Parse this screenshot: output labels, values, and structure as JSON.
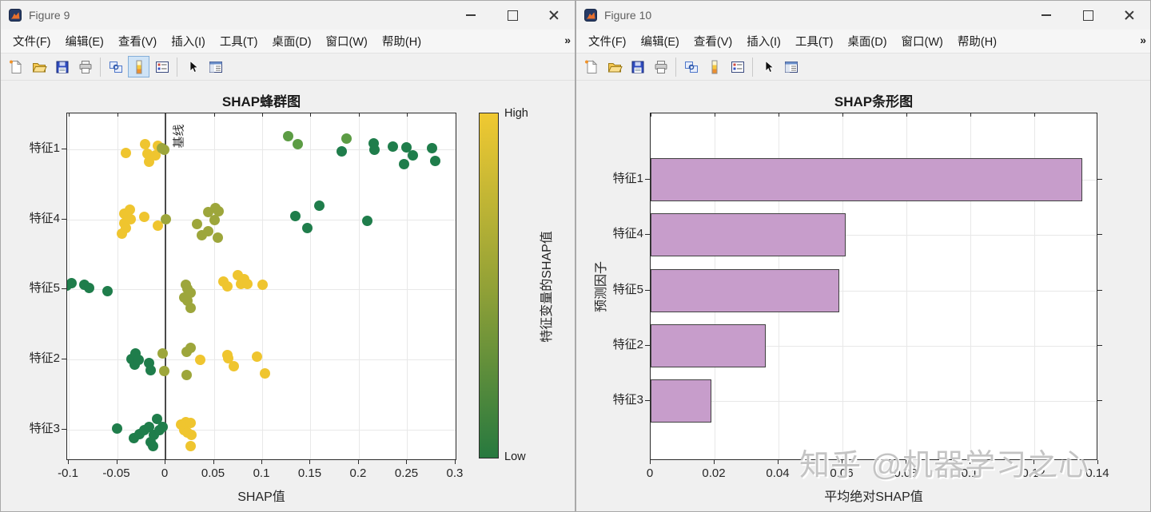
{
  "windows": {
    "left": {
      "title": "Figure 9",
      "active_tool": "insert-colorbar"
    },
    "right": {
      "title": "Figure 10",
      "active_tool": null
    }
  },
  "menu": [
    "文件(F)",
    "编辑(E)",
    "查看(V)",
    "插入(I)",
    "工具(T)",
    "桌面(D)",
    "窗口(W)",
    "帮助(H)"
  ],
  "icons": {
    "menu_overflow": "»"
  },
  "watermark": "知乎 @机器学习之心",
  "colors": {
    "figure_bg": "#F0F0F0",
    "axes_bg": "#FFFFFF",
    "grid": "#E8E8E8",
    "axis": "#2B2B2B",
    "baseline": "#4A4A4A",
    "watermark": "#C4C4C4",
    "toolbar_active_bg": "#CFE3F6",
    "toolbar_active_border": "#84AFD9",
    "cb_top": "#F0C932",
    "cb_mid": "#8FA037",
    "cb_bottom": "#27793F"
  },
  "chart_data": [
    {
      "type": "scatter",
      "title": "SHAP蜂群图",
      "xlabel": "SHAP值",
      "x_ticks": [
        "-0.1",
        "-0.05",
        "0",
        "0.05",
        "0.1",
        "0.15",
        "0.2",
        "0.25",
        "0.3"
      ],
      "xlim": [
        -0.1017,
        0.3017
      ],
      "categories": [
        "特征1",
        "特征4",
        "特征5",
        "特征2",
        "特征3"
      ],
      "baseline": {
        "x": 0,
        "label": "基线"
      },
      "colorbar": {
        "high": "High",
        "low": "Low",
        "label": "特征变量的SHAP值"
      },
      "point_colors": {
        "y": "#EFC52F",
        "o": "#9DA63B",
        "g": "#5C9C44",
        "d": "#1F7D4B"
      },
      "features": [
        {
          "name": "特征1",
          "points": [
            [
              -0.041,
              4,
              "y"
            ],
            [
              -0.021,
              -7,
              "y"
            ],
            [
              -0.019,
              5,
              "y"
            ],
            [
              -0.017,
              15,
              "y"
            ],
            [
              -0.01,
              7,
              "y"
            ],
            [
              -0.008,
              -5,
              "y"
            ],
            [
              -0.004,
              -2,
              "o"
            ],
            [
              -0.001,
              0,
              "o"
            ],
            [
              0.127,
              -17,
              "g"
            ],
            [
              0.137,
              -7,
              "g"
            ],
            [
              0.187,
              -14,
              "g"
            ],
            [
              0.182,
              2,
              "d"
            ],
            [
              0.215,
              -8,
              "d"
            ],
            [
              0.216,
              0,
              "d"
            ],
            [
              0.235,
              -4,
              "d"
            ],
            [
              0.249,
              -3,
              "d"
            ],
            [
              0.256,
              7,
              "d"
            ],
            [
              0.247,
              18,
              "d"
            ],
            [
              0.276,
              -2,
              "d"
            ],
            [
              0.279,
              14,
              "d"
            ]
          ]
        },
        {
          "name": "特征4",
          "points": [
            [
              -0.045,
              18,
              "y"
            ],
            [
              -0.043,
              -7,
              "y"
            ],
            [
              -0.043,
              5,
              "y"
            ],
            [
              -0.041,
              11,
              "y"
            ],
            [
              -0.037,
              -12,
              "y"
            ],
            [
              -0.036,
              0,
              "y"
            ],
            [
              -0.022,
              -3,
              "y"
            ],
            [
              -0.008,
              8,
              "y"
            ],
            [
              0,
              0,
              "o"
            ],
            [
              0.033,
              6,
              "o"
            ],
            [
              0.038,
              20,
              "o"
            ],
            [
              0.044,
              -9,
              "o"
            ],
            [
              0.044,
              15,
              "o"
            ],
            [
              0.051,
              1,
              "o"
            ],
            [
              0.052,
              -14,
              "o"
            ],
            [
              0.054,
              23,
              "o"
            ],
            [
              0.055,
              -10,
              "o"
            ],
            [
              0.134,
              -4,
              "d"
            ],
            [
              0.147,
              11,
              "d"
            ],
            [
              0.159,
              -17,
              "d"
            ],
            [
              0.209,
              2,
              "d"
            ]
          ]
        },
        {
          "name": "特征5",
          "points": [
            [
              -0.102,
              -5,
              "d"
            ],
            [
              -0.097,
              -8,
              "d"
            ],
            [
              -0.084,
              -6,
              "d"
            ],
            [
              -0.079,
              -2,
              "d"
            ],
            [
              -0.06,
              2,
              "d"
            ],
            [
              0.019,
              10,
              "o"
            ],
            [
              0.021,
              -6,
              "o"
            ],
            [
              0.023,
              -1,
              "o"
            ],
            [
              0.023,
              14,
              "o"
            ],
            [
              0.026,
              4,
              "o"
            ],
            [
              0.026,
              23,
              "o"
            ],
            [
              0.06,
              -10,
              "y"
            ],
            [
              0.064,
              -4,
              "y"
            ],
            [
              0.075,
              -18,
              "y"
            ],
            [
              0.078,
              -7,
              "y"
            ],
            [
              0.081,
              -13,
              "y"
            ],
            [
              0.085,
              -7,
              "y"
            ],
            [
              0.1,
              -6,
              "y"
            ]
          ]
        },
        {
          "name": "特征2",
          "points": [
            [
              -0.035,
              -1,
              "d"
            ],
            [
              -0.032,
              6,
              "d"
            ],
            [
              -0.031,
              -8,
              "d"
            ],
            [
              -0.028,
              0,
              "d"
            ],
            [
              -0.017,
              4,
              "d"
            ],
            [
              -0.015,
              13,
              "d"
            ],
            [
              -0.003,
              -8,
              "o"
            ],
            [
              -0.001,
              14,
              "o"
            ],
            [
              0.022,
              -10,
              "o"
            ],
            [
              0.022,
              19,
              "o"
            ],
            [
              0.026,
              -15,
              "o"
            ],
            [
              0.036,
              0,
              "y"
            ],
            [
              0.064,
              -6,
              "y"
            ],
            [
              0.065,
              -2,
              "y"
            ],
            [
              0.071,
              8,
              "y"
            ],
            [
              0.095,
              -4,
              "y"
            ],
            [
              0.103,
              17,
              "y"
            ]
          ]
        },
        {
          "name": "特征3",
          "points": [
            [
              -0.05,
              -1,
              "d"
            ],
            [
              -0.033,
              11,
              "d"
            ],
            [
              -0.027,
              6,
              "d"
            ],
            [
              -0.022,
              1,
              "d"
            ],
            [
              -0.017,
              -3,
              "d"
            ],
            [
              -0.015,
              16,
              "d"
            ],
            [
              -0.013,
              21,
              "d"
            ],
            [
              -0.012,
              7,
              "d"
            ],
            [
              -0.009,
              -13,
              "d"
            ],
            [
              -0.006,
              1,
              "d"
            ],
            [
              -0.003,
              -3,
              "d"
            ],
            [
              0.016,
              -6,
              "y"
            ],
            [
              0.019,
              1,
              "y"
            ],
            [
              0.021,
              -9,
              "y"
            ],
            [
              0.023,
              4,
              "y"
            ],
            [
              0.026,
              -8,
              "y"
            ],
            [
              0.026,
              21,
              "y"
            ],
            [
              0.027,
              7,
              "y"
            ]
          ]
        }
      ]
    },
    {
      "type": "bar",
      "title": "SHAP条形图",
      "xlabel": "平均绝对SHAP值",
      "ylabel": "预测因子",
      "x_ticks": [
        "0",
        "0.02",
        "0.04",
        "0.06",
        "0.08",
        "0.1",
        "0.12",
        "0.14"
      ],
      "xlim": [
        0,
        0.14
      ],
      "categories": [
        "特征1",
        "特征4",
        "特征5",
        "特征2",
        "特征3"
      ],
      "values": [
        0.135,
        0.061,
        0.059,
        0.036,
        0.019
      ],
      "bar_fill": "#C79DCB",
      "bar_edge": "#404040"
    }
  ]
}
